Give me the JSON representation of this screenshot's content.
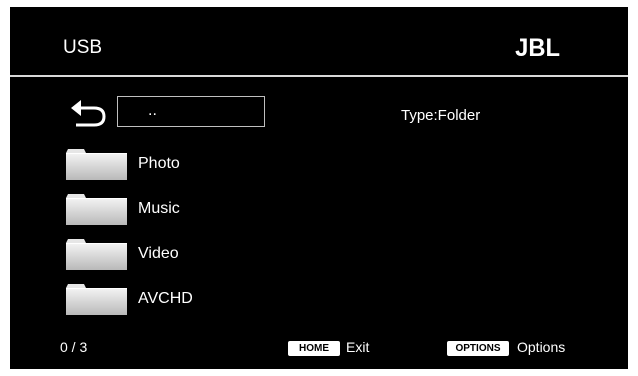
{
  "header": {
    "title": "USB",
    "brand": "JBL"
  },
  "browser": {
    "parent_entry": "..",
    "type_info": "Type:Folder",
    "items": [
      {
        "label": "Photo",
        "icon": "folder-icon"
      },
      {
        "label": "Music",
        "icon": "folder-icon"
      },
      {
        "label": "Video",
        "icon": "folder-icon"
      },
      {
        "label": "AVCHD",
        "icon": "folder-icon"
      }
    ]
  },
  "footer": {
    "page_counter": "0 / 3",
    "home_key": "HOME",
    "home_action": "Exit",
    "options_key": "OPTIONS",
    "options_action": "Options"
  },
  "colors": {
    "background": "#000000",
    "text": "#ffffff",
    "divider": "#d8d8d8"
  }
}
